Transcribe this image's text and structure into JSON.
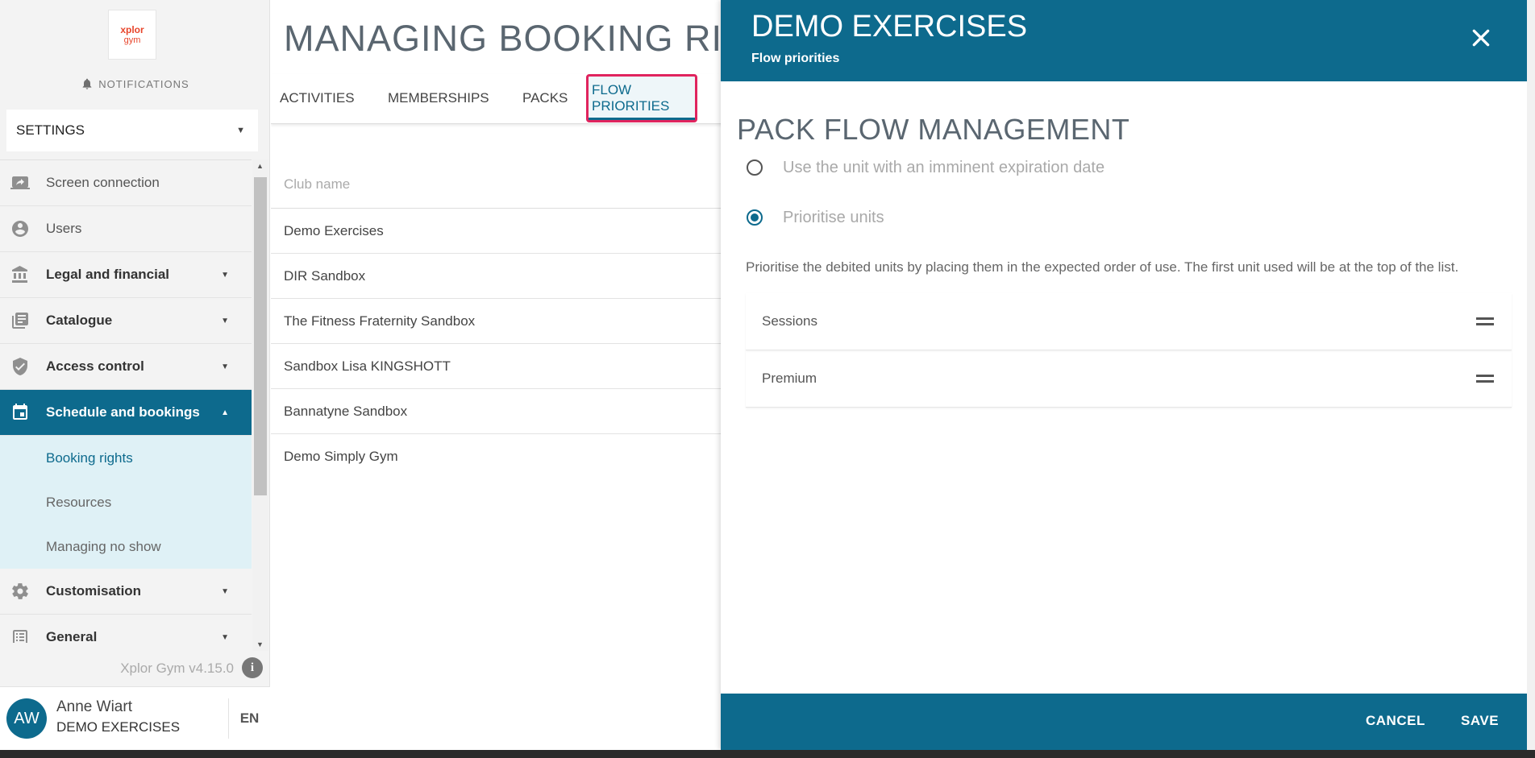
{
  "app": {
    "logo_line1": "xplor",
    "logo_line2": "gym",
    "notifications_label": "NOTIFICATIONS",
    "settings_select": "SETTINGS",
    "version": "Xplor Gym v4.15.0"
  },
  "sidebar": {
    "items": [
      {
        "label": "Screen connection",
        "icon": "screen-connection-icon"
      },
      {
        "label": "Users",
        "icon": "user-icon"
      },
      {
        "label": "Legal and financial",
        "icon": "bank-icon"
      },
      {
        "label": "Catalogue",
        "icon": "catalogue-icon"
      },
      {
        "label": "Access control",
        "icon": "shield-icon"
      },
      {
        "label": "Schedule and bookings",
        "icon": "calendar-icon"
      },
      {
        "label": "Customisation",
        "icon": "gear-icon"
      },
      {
        "label": "General",
        "icon": "list-icon"
      }
    ],
    "subitems": [
      "Booking rights",
      "Resources",
      "Managing no show"
    ]
  },
  "user": {
    "initials": "AW",
    "name": "Anne Wiart",
    "club": "DEMO EXERCISES",
    "language": "EN"
  },
  "main": {
    "title": "MANAGING BOOKING RIGHTS",
    "tabs": [
      "ACTIVITIES",
      "MEMBERSHIPS",
      "PACKS",
      "FLOW PRIORITIES"
    ],
    "active_tab": "FLOW PRIORITIES",
    "club_header": "Club name",
    "clubs": [
      "Demo Exercises",
      "DIR Sandbox",
      "The Fitness Fraternity Sandbox",
      "Sandbox Lisa KINGSHOTT",
      "Bannatyne Sandbox",
      "Demo Simply Gym"
    ]
  },
  "panel": {
    "title": "DEMO EXERCISES",
    "subtitle": "Flow priorities",
    "section_title": "PACK FLOW MANAGEMENT",
    "options": [
      {
        "label": "Use the unit with an imminent expiration date",
        "checked": false
      },
      {
        "label": "Prioritise units",
        "checked": true
      }
    ],
    "help_text": "Prioritise the debited units by placing them in the expected order of use. The first unit used will be at the top of the list.",
    "units": [
      "Sessions",
      "Premium"
    ],
    "cancel_label": "CANCEL",
    "save_label": "SAVE"
  },
  "colors": {
    "brand": "#0d6a8d",
    "highlight": "#e0245e",
    "submenu_bg": "#dff1f6"
  }
}
